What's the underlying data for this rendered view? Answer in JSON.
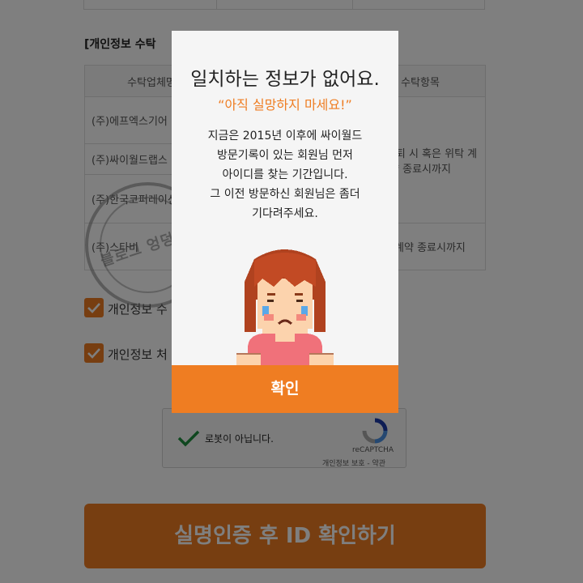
{
  "section_title": "[개인정보 수탁",
  "table": {
    "headers": [
      "수탁업체명",
      "",
      "수탁항목"
    ],
    "rows": [
      [
        "(주)에프엑스기어",
        "",
        ""
      ],
      [
        "(주)싸이월드랩스",
        "",
        "회원 탈퇴 시 혹은 위탁 계약 종료시까지"
      ],
      [
        "(주)한국코퍼레이션",
        "",
        ""
      ],
      [
        "(주)스타비",
        "",
        "위탁계약 종료시까지"
      ]
    ]
  },
  "checkboxes": [
    {
      "label": "개인정보 수",
      "checked": true
    },
    {
      "label": "개인정보 처",
      "checked": true
    }
  ],
  "recaptcha": {
    "label": "로봇이 아닙니다.",
    "brand": "reCAPTCHA",
    "terms": "개인정보 보호 - 약관"
  },
  "main_button": "실명인증 후 ID 확인하기",
  "watermark": {
    "text": "블로그 엉덩닷컴"
  },
  "modal": {
    "title": "일치하는 정보가 없어요.",
    "subtitle": "“아직 실망하지 마세요!”",
    "body": [
      "지금은 2015년 이후에 싸이월드",
      "방문기록이 있는 회원님 먼저",
      "아이디를 찾는 기간입니다.",
      "그 이전 방문하신 회원님은 좀더",
      "기다려주세요."
    ],
    "illustration": "crying-girl-pixel-art",
    "confirm": "확인"
  },
  "colors": {
    "accent": "#ef7d22",
    "overlay": "rgba(0,0,0,0.5)",
    "modal_bg": "#f5f5f5"
  }
}
